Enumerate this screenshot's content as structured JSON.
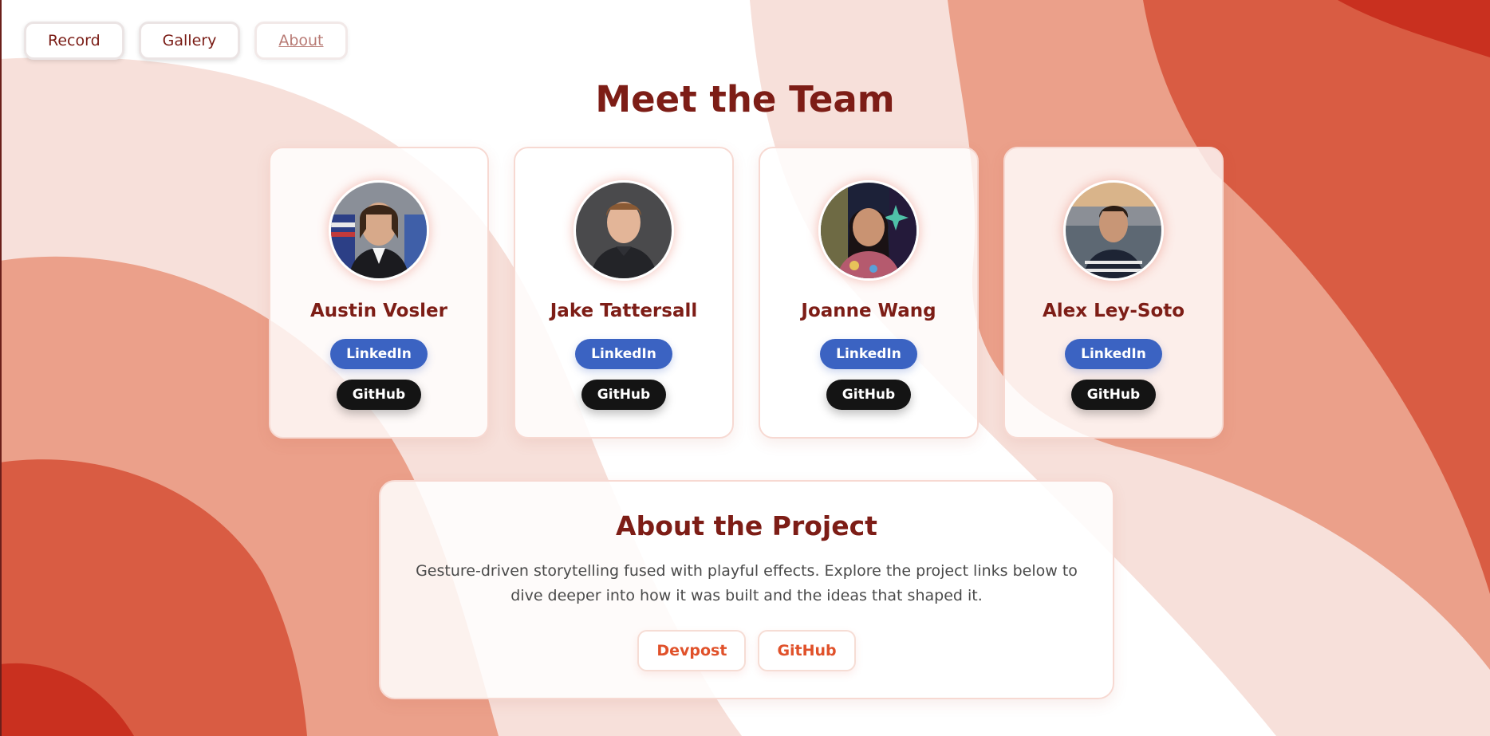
{
  "nav": {
    "items": [
      {
        "label": "Record",
        "active": false
      },
      {
        "label": "Gallery",
        "active": false
      },
      {
        "label": "About",
        "active": true
      }
    ]
  },
  "team": {
    "title": "Meet the Team",
    "members": [
      {
        "name": "Austin Vosler",
        "linkedin_label": "LinkedIn",
        "github_label": "GitHub"
      },
      {
        "name": "Jake Tattersall",
        "linkedin_label": "LinkedIn",
        "github_label": "GitHub"
      },
      {
        "name": "Joanne Wang",
        "linkedin_label": "LinkedIn",
        "github_label": "GitHub"
      },
      {
        "name": "Alex Ley-Soto",
        "linkedin_label": "LinkedIn",
        "github_label": "GitHub"
      }
    ]
  },
  "about": {
    "title": "About the Project",
    "description": "Gesture-driven storytelling fused with playful effects. Explore the project links below to dive deeper into how it was built and the ideas that shaped it.",
    "links": [
      {
        "label": "Devpost"
      },
      {
        "label": "GitHub"
      }
    ]
  },
  "colors": {
    "heading": "#7d1d16",
    "linkedin": "#3b63c2",
    "github": "#141414",
    "accent": "#e0512a",
    "wave_light": "#f7e0da",
    "wave_mid": "#eba08a",
    "wave_dark": "#d95c43",
    "wave_deep": "#c9301f"
  }
}
